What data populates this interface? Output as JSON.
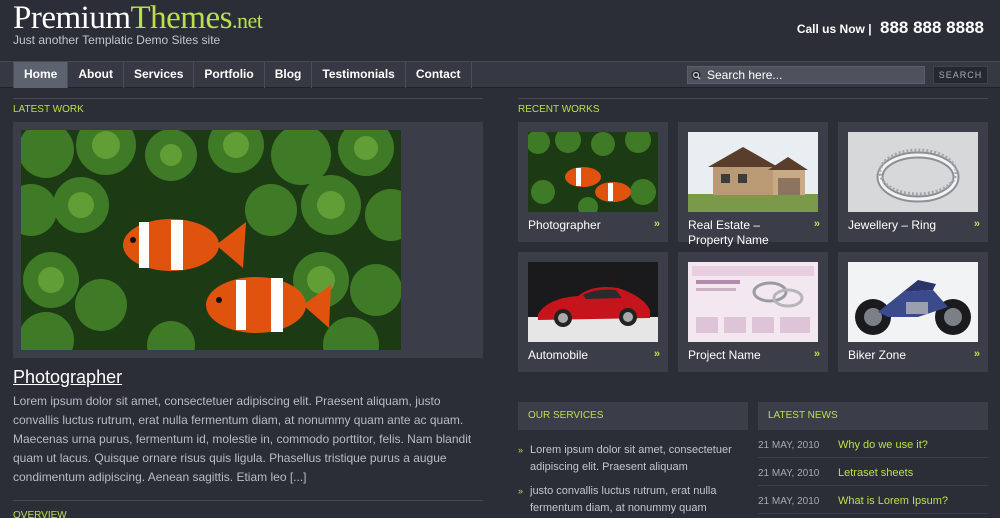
{
  "header": {
    "logo_part1": "Premium",
    "logo_part2": "Themes",
    "logo_part3": ".net",
    "tagline": "Just another Templatic Demo Sites site",
    "call_label": "Call us Now |",
    "call_number": "888 888 8888"
  },
  "nav": {
    "items": [
      {
        "label": "Home"
      },
      {
        "label": "Portfolio"
      }
    ]
  },
  "nav_labels": [
    "Home",
    "About",
    "Services",
    "Portfolio",
    "Blog",
    "Testimonials",
    "Contact"
  ],
  "search": {
    "placeholder": "Search here...",
    "button_label": "SEARCH"
  },
  "latest_work": {
    "heading": "LATEST WORK",
    "title": "Photographer",
    "text": "Lorem ipsum dolor sit amet, consectetuer adipiscing elit. Praesent aliquam, justo convallis luctus rutrum, erat nulla fermentum diam, at nonummy quam ante ac quam. Maecenas urna purus, fermentum id, molestie in, commodo porttitor, felis. Nam blandit quam ut lacus. Quisque ornare risus quis ligula. Phasellus tristique purus a augue condimentum adipiscing. Aenean sagittis. Etiam leo [...]"
  },
  "overview_heading": "OVERVIEW",
  "recent_works": {
    "heading": "RECENT WORKS",
    "items": [
      {
        "caption": "Photographer",
        "arrow": "»"
      },
      {
        "caption": "Real Estate – Property Name",
        "arrow": "»"
      },
      {
        "caption": "Jewellery – Ring",
        "arrow": "»"
      },
      {
        "caption": "Automobile",
        "arrow": "»"
      },
      {
        "caption": "Project Name",
        "arrow": "»"
      },
      {
        "caption": "Biker Zone",
        "arrow": "»"
      }
    ]
  },
  "services": {
    "heading": "OUR SERVICES",
    "items": [
      "Lorem ipsum dolor sit amet, consectetuer adipiscing elit. Praesent aliquam",
      "justo convallis luctus rutrum, erat nulla fermentum diam, at nonummy quam"
    ]
  },
  "news": {
    "heading": "LATEST NEWS",
    "items": [
      {
        "date": "21 MAY, 2010",
        "title": "Why do we use it?"
      },
      {
        "date": "21 MAY, 2010",
        "title": "Letraset sheets"
      },
      {
        "date": "21 MAY, 2010",
        "title": "What is Lorem Ipsum?"
      }
    ]
  },
  "colors": {
    "background": "#2b2e37",
    "accent": "#b8e04a",
    "panel": "#3b3e48"
  }
}
